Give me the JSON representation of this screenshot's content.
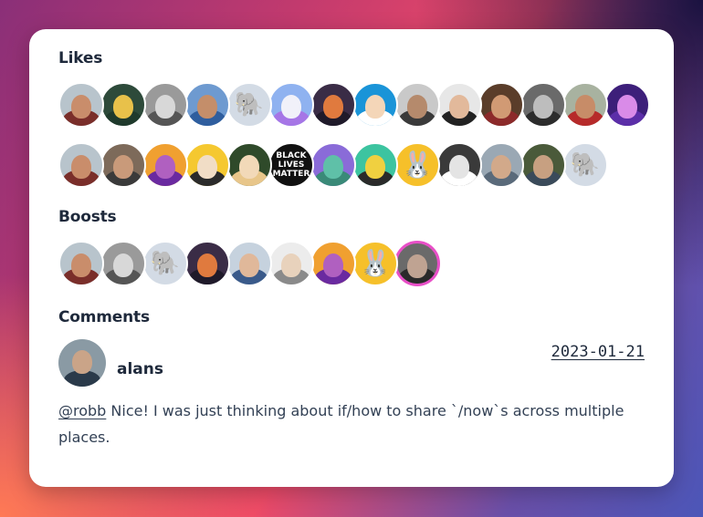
{
  "sections": {
    "likes_title": "Likes",
    "boosts_title": "Boosts",
    "comments_title": "Comments"
  },
  "likes": [
    {
      "bg": "#b8c4cc",
      "skin": "#c98d6b",
      "shirt": "#7a2e2a",
      "icon": "person-photo-icon"
    },
    {
      "bg": "#2d4a3a",
      "skin": "#e8c14a",
      "shirt": "#1f3a2c",
      "icon": "gecko-photo-icon"
    },
    {
      "bg": "#9a9a9a",
      "skin": "#d8d8d8",
      "shirt": "#555555",
      "icon": "person-photo-icon"
    },
    {
      "bg": "#6e9ad0",
      "skin": "#c48e6a",
      "shirt": "#2f5e9e",
      "icon": "person-photo-icon"
    },
    {
      "bg": "#d3dbe5",
      "skin": "#d3dbe5",
      "shirt": "#d3dbe5",
      "icon": "elephant-placeholder-icon"
    },
    {
      "bg": "#8fb2f0",
      "skin": "#f1f1f9",
      "shirt": "#a676e6",
      "icon": "santa-octopus-icon"
    },
    {
      "bg": "#3a2c46",
      "skin": "#e07a3e",
      "shirt": "#1f1a2a",
      "icon": "sunset-photo-icon"
    },
    {
      "bg": "#1a94d8",
      "skin": "#f4d6b8",
      "shirt": "#ffffff",
      "icon": "cartoon-face-icon"
    },
    {
      "bg": "#c9c9c9",
      "skin": "#b58a6c",
      "shirt": "#3a3a3a",
      "icon": "person-photo-icon"
    },
    {
      "bg": "#e7e7e7",
      "skin": "#e2b99b",
      "shirt": "#222222",
      "icon": "sunglasses-photo-icon"
    },
    {
      "bg": "#5a3d2a",
      "skin": "#d19a74",
      "shirt": "#8c2a2a",
      "icon": "person-photo-icon"
    },
    {
      "bg": "#6a6a6a",
      "skin": "#bdbdbd",
      "shirt": "#2c2c2c",
      "icon": "person-photo-icon"
    },
    {
      "bg": "#a8b2a0",
      "skin": "#c78c68",
      "shirt": "#b62a2a",
      "icon": "person-photo-icon"
    },
    {
      "bg": "#3d1f7a",
      "skin": "#d98be8",
      "shirt": "#5b2ea8",
      "icon": "neon-photo-icon"
    },
    {
      "bg": "#b8c4cc",
      "skin": "#c98d6b",
      "shirt": "#7a2e2a",
      "icon": "person-photo-icon"
    },
    {
      "bg": "#7d6a5a",
      "skin": "#c99a7a",
      "shirt": "#3a3a3a",
      "icon": "person-photo-icon"
    },
    {
      "bg": "#f0a030",
      "skin": "#b060c0",
      "shirt": "#6a2aa0",
      "icon": "illustrated-woman-icon"
    },
    {
      "bg": "#f5c830",
      "skin": "#f1ddc6",
      "shirt": "#2b2b2b",
      "icon": "cartoon-face-icon"
    },
    {
      "bg": "#2f4a2a",
      "skin": "#f2d9b8",
      "shirt": "#e8c68a",
      "icon": "person-photo-icon"
    },
    {
      "bg": "#111111",
      "skin": "#111111",
      "shirt": "#111111",
      "icon": "black-lives-matter-icon",
      "text": "BLACK LIVES MATTER"
    },
    {
      "bg": "#8a6bd8",
      "skin": "#5fc0a8",
      "shirt": "#3a8a78",
      "icon": "green-creature-icon"
    },
    {
      "bg": "#3cc4a0",
      "skin": "#f0d040",
      "shirt": "#2a2a2a",
      "icon": "pixel-face-icon"
    },
    {
      "bg": "#f6c02a",
      "skin": "#f6c02a",
      "shirt": "#f6c02a",
      "icon": "bunny-icon",
      "glyph": "🐰"
    },
    {
      "bg": "#3a3a3a",
      "skin": "#e4e4e4",
      "shirt": "#ffffff",
      "icon": "person-photo-icon"
    },
    {
      "bg": "#9aa8b4",
      "skin": "#d2a98a",
      "shirt": "#5a6a7a",
      "icon": "person-photo-icon"
    },
    {
      "bg": "#4a5a3a",
      "skin": "#c7a081",
      "shirt": "#3a4a5a",
      "icon": "couple-photo-icon"
    },
    {
      "bg": "#d3dbe5",
      "skin": "#d3dbe5",
      "shirt": "#d3dbe5",
      "icon": "elephant-placeholder-icon"
    }
  ],
  "boosts": [
    {
      "bg": "#b8c4cc",
      "skin": "#c98d6b",
      "shirt": "#7a2e2a",
      "icon": "person-photo-icon"
    },
    {
      "bg": "#9a9a9a",
      "skin": "#d8d8d8",
      "shirt": "#555555",
      "icon": "person-photo-icon"
    },
    {
      "bg": "#d3dbe5",
      "skin": "#d3dbe5",
      "shirt": "#d3dbe5",
      "icon": "elephant-placeholder-icon"
    },
    {
      "bg": "#3a2c46",
      "skin": "#e07a3e",
      "shirt": "#1f1a2a",
      "icon": "sunset-photo-icon"
    },
    {
      "bg": "#c6d2de",
      "skin": "#e0b89a",
      "shirt": "#3a5a8a",
      "icon": "person-photo-icon"
    },
    {
      "bg": "#ececec",
      "skin": "#e8d2bc",
      "shirt": "#8a8a8a",
      "icon": "sketch-face-icon"
    },
    {
      "bg": "#f0a030",
      "skin": "#b060c0",
      "shirt": "#6a2aa0",
      "icon": "illustrated-woman-icon"
    },
    {
      "bg": "#f6c02a",
      "skin": "#f6c02a",
      "shirt": "#f6c02a",
      "icon": "bunny-icon",
      "glyph": "🐰"
    },
    {
      "bg": "#6a6a6a",
      "skin": "#bfa392",
      "shirt": "#2a2a2a",
      "icon": "person-photo-icon",
      "highlight": true
    }
  ],
  "comment": {
    "user": "alans",
    "date": "2023-01-21",
    "mention": "@robb",
    "text": " Nice! I was just thinking about if/how to share `/now`s across multiple places.",
    "avatar": {
      "bg": "#8a9aa4",
      "skin": "#caa488",
      "shirt": "#2a3a4a"
    }
  }
}
